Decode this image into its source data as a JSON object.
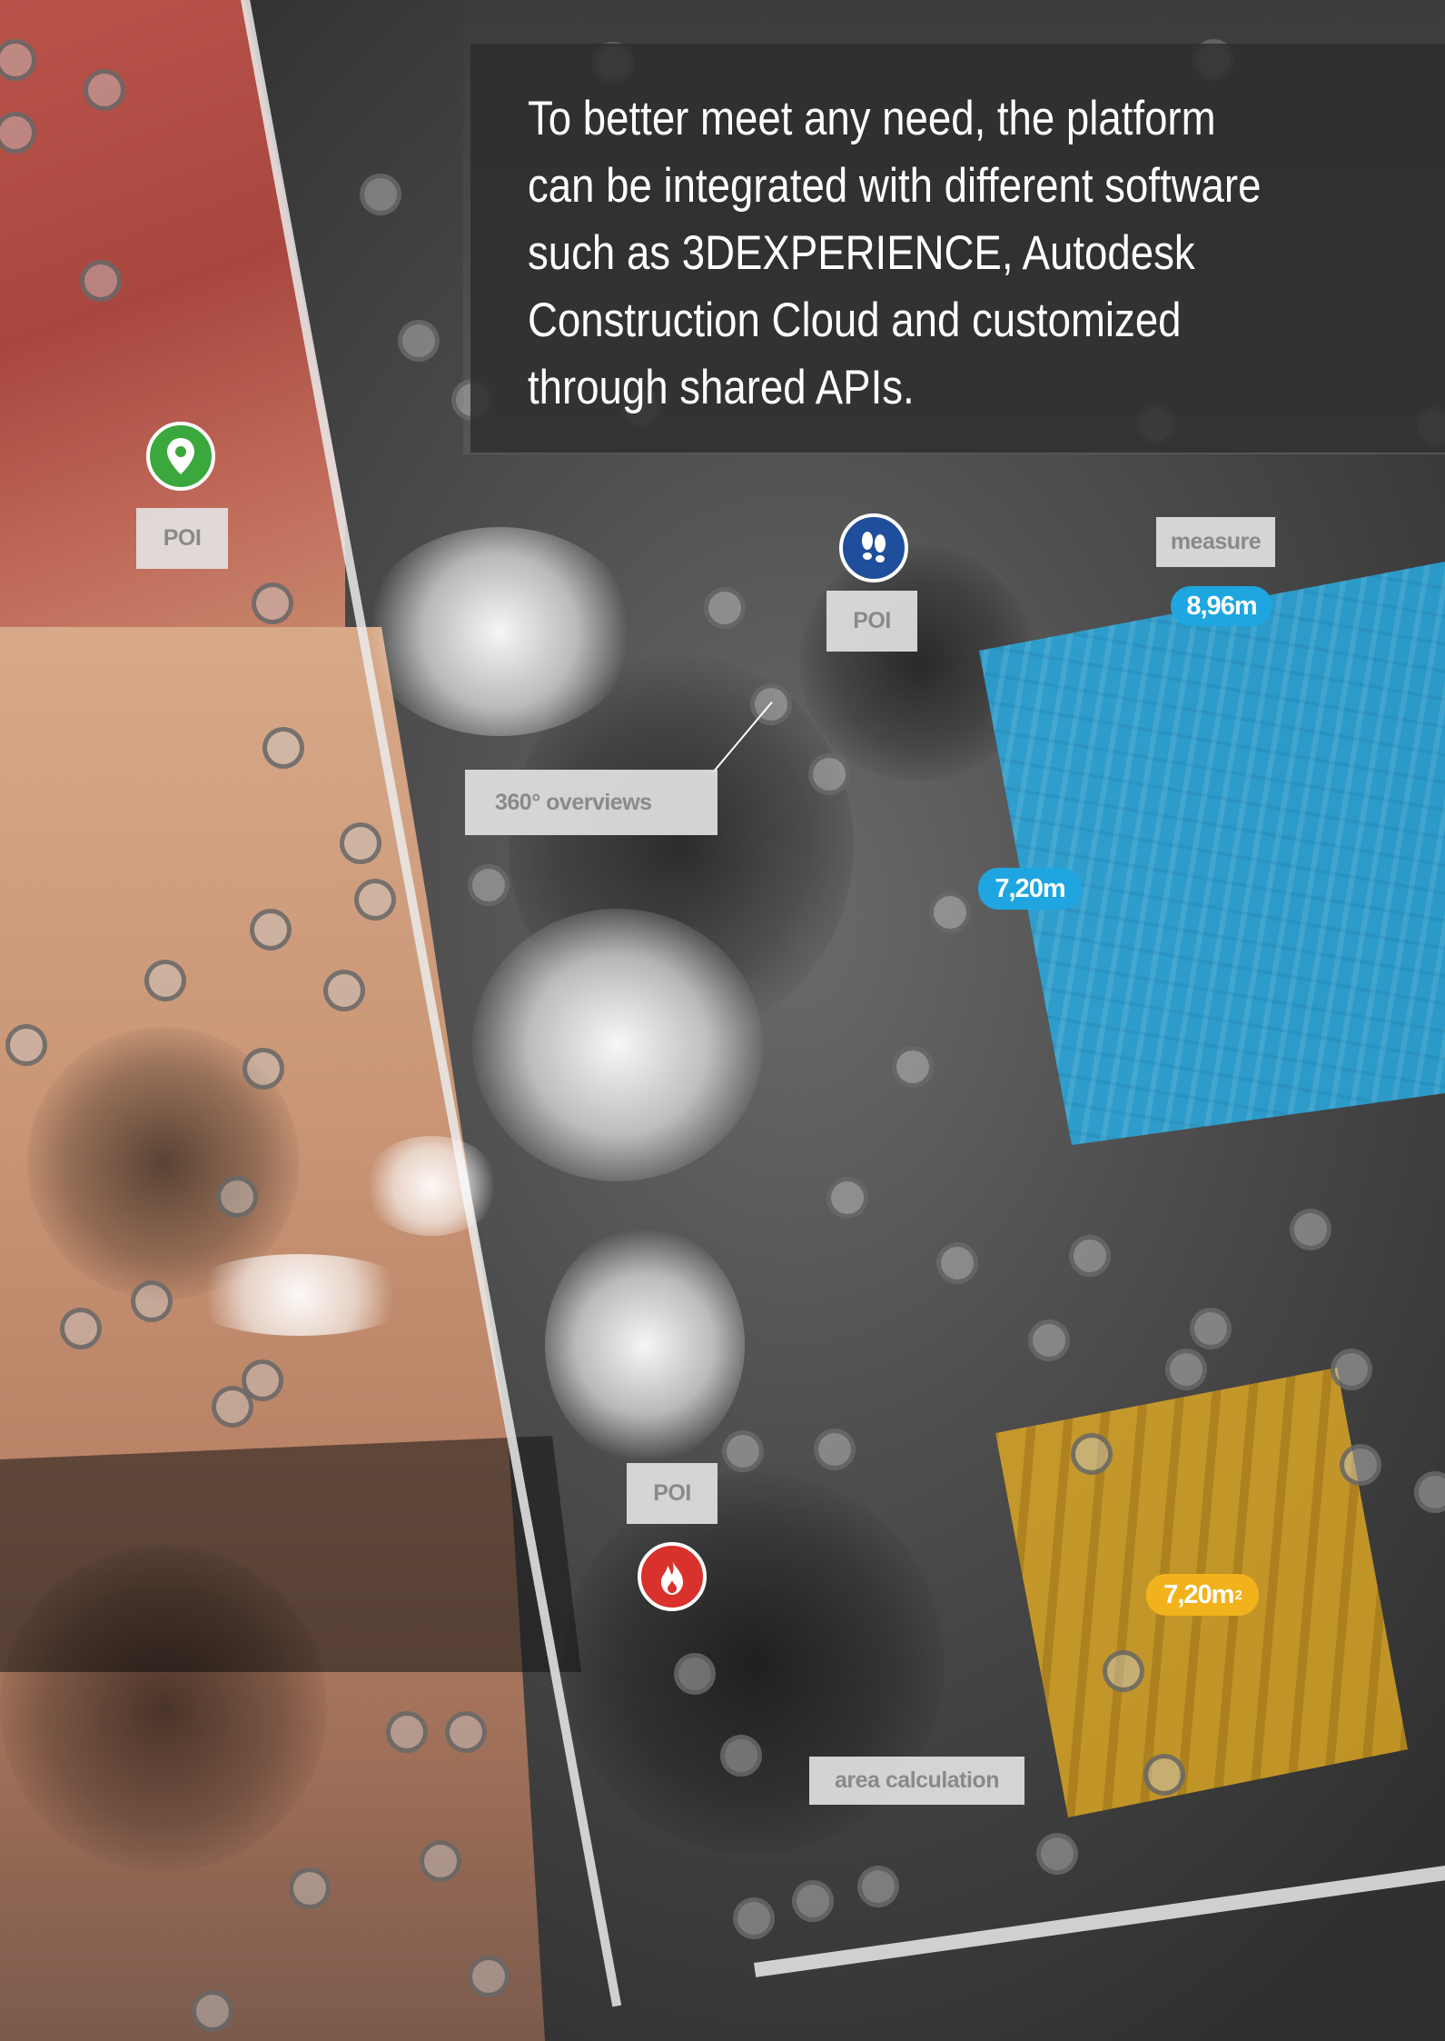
{
  "info_panel": {
    "text": "To better meet any need, the platform can be integrated with different software such as 3DEXPERIENCE, Autodesk Construction Cloud and customized through shared APIs."
  },
  "labels": {
    "poi_left": "POI",
    "poi_top": "POI",
    "poi_bottom": "POI",
    "measure": "measure",
    "overviews": "360° overviews",
    "area_calculation": "area calculation"
  },
  "measurements": {
    "width": "8,96m",
    "height": "7,20m",
    "area_value": "7,20m",
    "area_unit_sup": "2"
  },
  "icons": {
    "poi_left": "map-pin-icon",
    "poi_top": "footprints-icon",
    "poi_bottom": "fire-icon"
  },
  "colors": {
    "measure_blue": "#1fa6e0",
    "area_yellow": "#f2b21b",
    "poi_green": "#3aa83c",
    "poi_blue": "#1f4e9c",
    "poi_red": "#d9312b"
  }
}
